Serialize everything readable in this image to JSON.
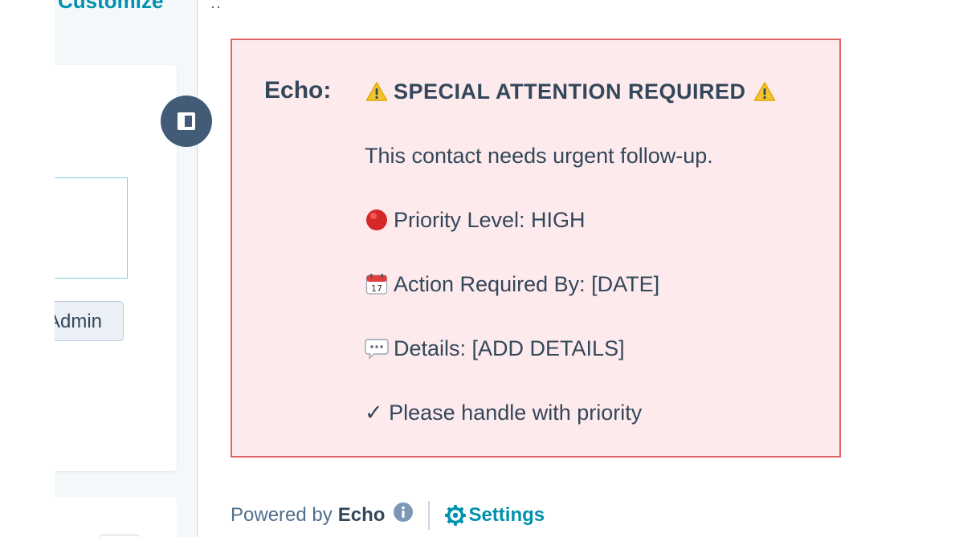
{
  "sidebar": {
    "customize_label": "Customize",
    "admin_label": "Admin"
  },
  "alert": {
    "label": "Echo:",
    "heading": "SPECIAL ATTENTION REQUIRED",
    "message": "This contact needs urgent follow-up.",
    "priority": "Priority Level: HIGH",
    "action_by": "Action Required By: [DATE]",
    "details": "Details: [ADD DETAILS]",
    "closing": "✓ Please handle with priority",
    "icons": {
      "warning": "warning-icon",
      "priority": "red-circle-icon",
      "date": "calendar-icon",
      "details": "speech-bubble-icon"
    },
    "colors": {
      "border": "#e06666",
      "background": "#fdeaec",
      "text": "#33475b"
    }
  },
  "footer": {
    "powered_by": "Powered by",
    "brand": "Echo",
    "settings_label": "Settings",
    "link_color": "#0091ae"
  }
}
